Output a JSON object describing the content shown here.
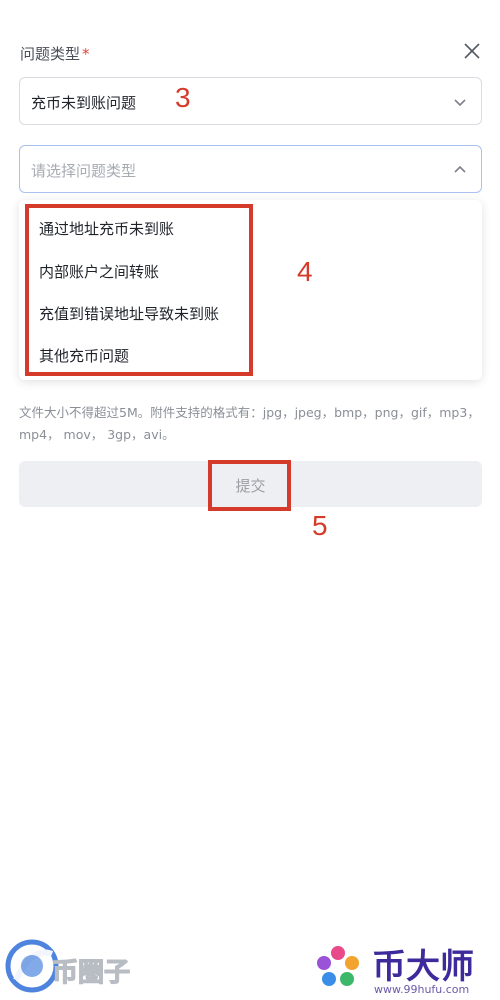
{
  "form": {
    "label": "问题类型",
    "required_mark": "*"
  },
  "select_primary": {
    "value": "充币未到账问题"
  },
  "select_secondary": {
    "placeholder": "请选择问题类型",
    "options": [
      {
        "label": "通过地址充币未到账"
      },
      {
        "label": "内部账户之间转账"
      },
      {
        "label": "充值到错误地址导致未到账"
      },
      {
        "label": "其他充币问题"
      }
    ]
  },
  "upload_hint": "文件大小不得超过5M。附件支持的格式有：jpg，jpeg，bmp，png，gif，mp3， mp4， mov， 3gp，avi。",
  "submit": {
    "label": "提交"
  },
  "annotations": {
    "step_3": "3",
    "step_4": "4",
    "step_5": "5",
    "color": "#d43b2a"
  },
  "watermarks": {
    "left_brand": "币圈子",
    "right_brand": "币大师",
    "right_url": "www.99hufu.com"
  },
  "icons": {
    "close": "close-icon",
    "chevron_down": "chevron-down-icon",
    "chevron_up": "chevron-up-icon"
  }
}
